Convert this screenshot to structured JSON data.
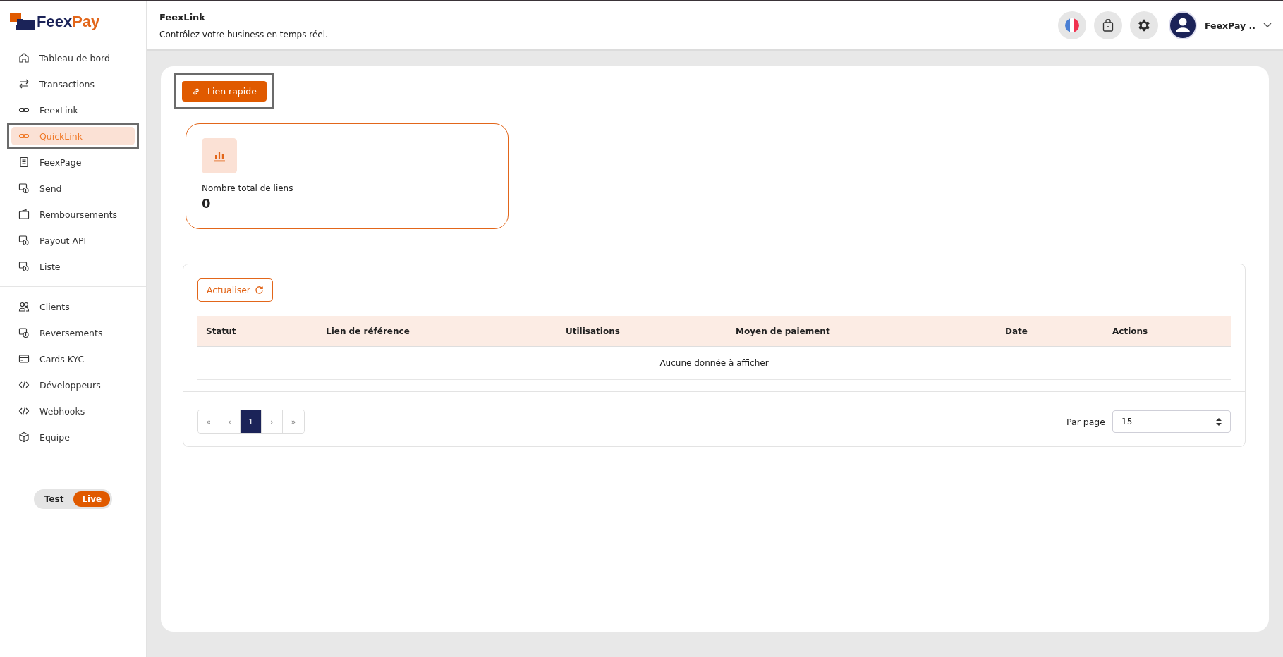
{
  "sidebar": {
    "logo": {
      "text_1": "Feex",
      "text_2": "Pay"
    },
    "groups": [
      [
        {
          "label": "Tableau de bord",
          "kind": "home",
          "selected": false,
          "highlighted": false
        },
        {
          "label": "Transactions",
          "kind": "arrows",
          "selected": false,
          "highlighted": false
        },
        {
          "label": "FeexLink",
          "kind": "link",
          "selected": false,
          "highlighted": false
        },
        {
          "label": "QuickLink",
          "kind": "link",
          "selected": true,
          "highlighted": true
        },
        {
          "label": "FeexPage",
          "kind": "doc",
          "selected": false,
          "highlighted": false
        },
        {
          "label": "Send",
          "kind": "money",
          "selected": false,
          "highlighted": false
        },
        {
          "label": "Remboursements",
          "kind": "wallet",
          "selected": false,
          "highlighted": false
        },
        {
          "label": "Payout API",
          "kind": "money",
          "selected": false,
          "highlighted": false
        },
        {
          "label": "Liste",
          "kind": "money",
          "selected": false,
          "highlighted": false
        }
      ],
      [
        {
          "label": "Clients",
          "kind": "users",
          "selected": false,
          "highlighted": false
        },
        {
          "label": "Reversements",
          "kind": "money",
          "selected": false,
          "highlighted": false
        },
        {
          "label": "Cards KYC",
          "kind": "card",
          "selected": false,
          "highlighted": false
        },
        {
          "label": "Développeurs",
          "kind": "code",
          "selected": false,
          "highlighted": false
        },
        {
          "label": "Webhooks",
          "kind": "code",
          "selected": false,
          "highlighted": false
        },
        {
          "label": "Equipe",
          "kind": "cube",
          "selected": false,
          "highlighted": false
        }
      ]
    ],
    "mode_toggle": [
      {
        "label": "Test",
        "selected": false
      },
      {
        "label": "Live",
        "selected": true
      }
    ]
  },
  "header": {
    "title": "FeexLink",
    "subtitle": "Contrôlez votre business en temps réel.",
    "user_name": "FeexPay .."
  },
  "quick_link_button": {
    "label": "Lien rapide",
    "highlighted": true
  },
  "stat_card": {
    "label": "Nombre total de liens",
    "value": "0"
  },
  "refresh_button": {
    "label": "Actualiser"
  },
  "table": {
    "columns": [
      "Statut",
      "Lien de référence",
      "Utilisations",
      "Moyen de paiement",
      "Date",
      "Actions"
    ],
    "empty_message": "Aucune donnée à afficher"
  },
  "pagination": [
    {
      "label": "«",
      "selected": false
    },
    {
      "label": "‹",
      "selected": false
    },
    {
      "label": "1",
      "selected": true
    },
    {
      "label": "›",
      "selected": false
    },
    {
      "label": "»",
      "selected": false
    }
  ],
  "per_page": {
    "label": "Par page",
    "value": "15"
  }
}
